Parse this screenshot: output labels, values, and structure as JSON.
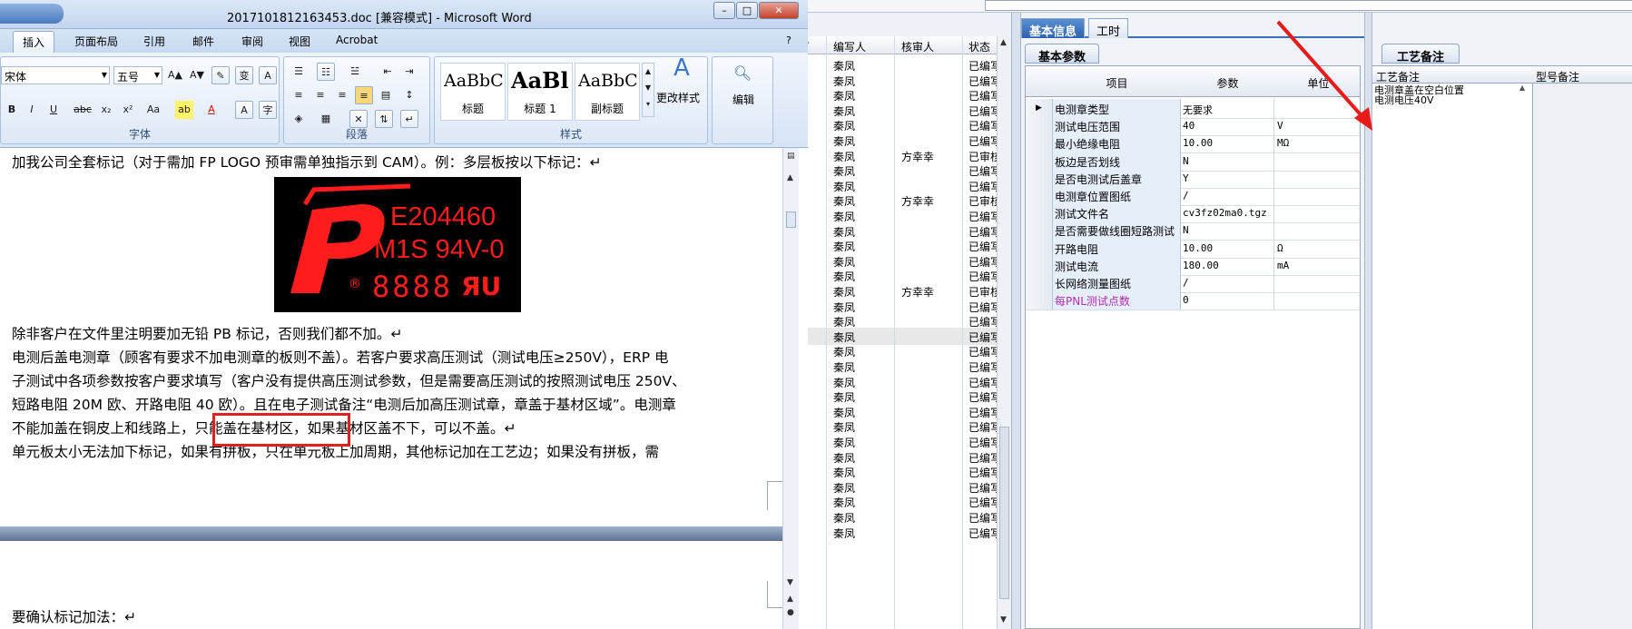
{
  "word": {
    "title": "2017101812163453.doc [兼容模式] - Microsoft Word",
    "tabs": [
      "插入",
      "页面布局",
      "引用",
      "邮件",
      "审阅",
      "视图",
      "Acrobat"
    ],
    "active_tab": "插入",
    "font_name": "宋体",
    "font_size": "五号",
    "group_font": "字体",
    "group_paragraph": "段落",
    "group_styles": "样式",
    "styles": [
      {
        "preview": "AaBbC",
        "name": "标题"
      },
      {
        "preview": "AaBl",
        "name": "标题 1"
      },
      {
        "preview": "AaBbC",
        "name": "副标题"
      }
    ],
    "change_styles": "更改样式",
    "edit": "编辑",
    "doc_lines": [
      "加我公司全套标记（对于需加 FP  LOGO 预审需单独指示到 CAM）。例：多层板按以下标记：↵",
      "除非客户在文件里注明要加无铅 PB 标记，否则我们都不加。↵",
      "电测后盖电测章（顾客有要求不加电测章的板则不盖）。若客户要求高压测试（测试电压≥250V），ERP 电",
      "子测试中各项参数按客户要求填写（客户没有提供高压测试参数，但是需要高压测试的按照测试电压 250V、",
      "短路电阻 20M 欧、开路电阻 40 欧）。且在电子测试备注“电测后加高压测试章，章盖于基材区域”。电测章",
      "不能加盖在铜皮上和线路上，只能盖在基材区，如果基材区盖不下，可以不盖。↵",
      "单元板太小无法加下标记，如果有拼板，只在单元板上加周期，其他标记加在工艺边；如果没有拼板，需"
    ],
    "lower_line": "要确认标记加法：↵",
    "logo": {
      "code": "E204460",
      "spec": "M1S 94V-0",
      "date": "8888"
    }
  },
  "list": {
    "headers": [
      "编写人",
      "核审人",
      "状态"
    ],
    "rows": [
      [
        "秦凤",
        "",
        "已编写"
      ],
      [
        "秦凤",
        "",
        "已编写"
      ],
      [
        "秦凤",
        "",
        "已编写"
      ],
      [
        "秦凤",
        "",
        "已编写"
      ],
      [
        "秦凤",
        "",
        "已编写"
      ],
      [
        "秦凤",
        "",
        "已编写"
      ],
      [
        "秦凤",
        "方幸幸",
        "已审核"
      ],
      [
        "秦凤",
        "",
        "已编写"
      ],
      [
        "秦凤",
        "",
        "已编写"
      ],
      [
        "秦凤",
        "方幸幸",
        "已审核"
      ],
      [
        "秦凤",
        "",
        "已编写"
      ],
      [
        "秦凤",
        "",
        "已编写"
      ],
      [
        "秦凤",
        "",
        "已编写"
      ],
      [
        "秦凤",
        "",
        "已编写"
      ],
      [
        "秦凤",
        "",
        "已编写"
      ],
      [
        "秦凤",
        "方幸幸",
        "已审核"
      ],
      [
        "秦凤",
        "",
        "已编写"
      ],
      [
        "秦凤",
        "",
        "已编写"
      ],
      [
        "秦凤",
        "",
        "已编写"
      ],
      [
        "秦凤",
        "",
        "已编写"
      ],
      [
        "秦凤",
        "",
        "已编写"
      ],
      [
        "秦凤",
        "",
        "已编写"
      ],
      [
        "秦凤",
        "",
        "已编写"
      ],
      [
        "秦凤",
        "",
        "已编写"
      ],
      [
        "秦凤",
        "",
        "已编写"
      ],
      [
        "秦凤",
        "",
        "已编写"
      ],
      [
        "秦凤",
        "",
        "已编写"
      ],
      [
        "秦凤",
        "",
        "已编写"
      ],
      [
        "秦凤",
        "",
        "已编写"
      ],
      [
        "秦凤",
        "",
        "已编写"
      ],
      [
        "秦凤",
        "",
        "已编写"
      ],
      [
        "秦凤",
        "",
        "已编写"
      ]
    ],
    "selected_row": 18
  },
  "detail": {
    "tabs": [
      "基本信息",
      "工时"
    ],
    "active_tab": "基本信息",
    "subtab": "基本参数",
    "columns": [
      "项目",
      "参数",
      "单位"
    ],
    "rows": [
      {
        "item": "电测章类型",
        "value": "无要求",
        "unit": ""
      },
      {
        "item": "测试电压范围",
        "value": "40",
        "unit": "V"
      },
      {
        "item": "最小绝缘电阻",
        "value": "10.00",
        "unit": "MΩ"
      },
      {
        "item": "板边是否划线",
        "value": "N",
        "unit": ""
      },
      {
        "item": "是否电测试后盖章",
        "value": "Y",
        "unit": ""
      },
      {
        "item": "电测章位置图纸",
        "value": "/",
        "unit": ""
      },
      {
        "item": "测试文件名",
        "value": "cv3fz02ma0.tgz",
        "unit": ""
      },
      {
        "item": "是否需要做线圈短路测试",
        "value": "N",
        "unit": ""
      },
      {
        "item": "开路电阻",
        "value": "10.00",
        "unit": "Ω"
      },
      {
        "item": "测试电流",
        "value": "180.00",
        "unit": "mA"
      },
      {
        "item": "长网络测量图纸",
        "value": "/",
        "unit": ""
      },
      {
        "item": "每PNL测试点数",
        "value": "0",
        "unit": ""
      }
    ]
  },
  "notes": {
    "tab": "工艺备注",
    "columns": [
      "工艺备注",
      "型号备注"
    ],
    "lines": [
      "电测章盖在空白位置",
      "电测电压40V"
    ]
  },
  "colors": {
    "highlight_box": "#e32020",
    "arrow": "#e81a1a",
    "logo_red": "#ff1c1c"
  }
}
